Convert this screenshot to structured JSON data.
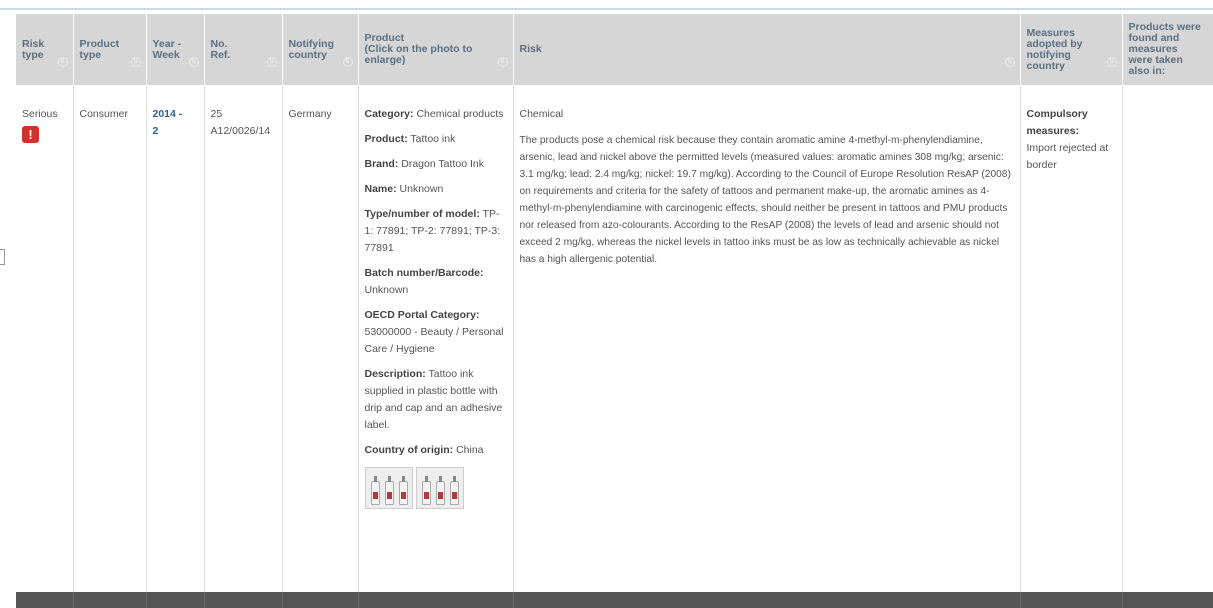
{
  "headers": {
    "risk_type": "Risk\ntype",
    "product_type": "Product\ntype",
    "year_week": "Year -\nWeek",
    "ref": "No.\nRef.",
    "notifying_country": "Notifying\ncountry",
    "product": "Product\n(Click on the photo to\nenlarge)",
    "risk": "Risk",
    "measures": "Measures\nadopted by\nnotifying\ncountry",
    "found_also": "Products were\nfound and\nmeasures\nwere taken\nalso in:"
  },
  "row": {
    "risk_type": "Serious",
    "risk_badge": "!",
    "product_type": "Consumer",
    "year_week": "2014 -\n2",
    "ref": "25\nA12/0026/14",
    "notifying_country": "Germany",
    "product": {
      "category_label": "Category:",
      "category": "Chemical products",
      "product_label": "Product:",
      "product": "Tattoo ink",
      "brand_label": "Brand:",
      "brand": "Dragon Tattoo Ink",
      "name_label": "Name:",
      "name": "Unknown",
      "model_label": "Type/number of model:",
      "model": "TP-1: 77891; TP-2: 77891; TP-3: 77891",
      "batch_label": "Batch number/Barcode:",
      "batch": "Unknown",
      "oecd_label": "OECD Portal Category:",
      "oecd": "53000000 - Beauty / Personal Care / Hygiene",
      "description_label": "Description:",
      "description": "Tattoo ink supplied in plastic bottle with drip and cap and an adhesive label.",
      "origin_label": "Country of origin:",
      "origin": "China"
    },
    "risk_title": "Chemical",
    "risk_text": "The products pose a chemical risk because they contain aromatic amine 4-methyl-m-phenylendiamine, arsenic, lead and nickel above the permitted levels (measured values: aromatic amines 308 mg/kg; arsenic: 3.1 mg/kg; lead: 2.4 mg/kg; nickel: 19.7 mg/kg). According to the Council of Europe Resolution ResAP (2008) on requirements and criteria for the safety of tattoos and permanent make-up, the aromatic amines as 4-methyl-m-phenylendiamine with carcinogenic effects, should neither be present in tattoos and PMU products nor released from azo-colourants. According to the ResAP (2008) the levels of lead and arsenic should not exceed 2 mg/kg, whereas the nickel levels in tattoo inks must be as low as technically achievable as nickel has a high allergenic potential.",
    "measures_label": "Compulsory measures:",
    "measures": "Import rejected at border",
    "found_also": ""
  },
  "colors": {
    "header_bg": "#d6d6d6",
    "header_text": "#5a6f82",
    "link": "#2c5f97",
    "badge": "#d62d2d",
    "footer_bar": "#555555"
  },
  "icons": [
    "sort-icon",
    "warning-icon",
    "bottle-photo"
  ]
}
